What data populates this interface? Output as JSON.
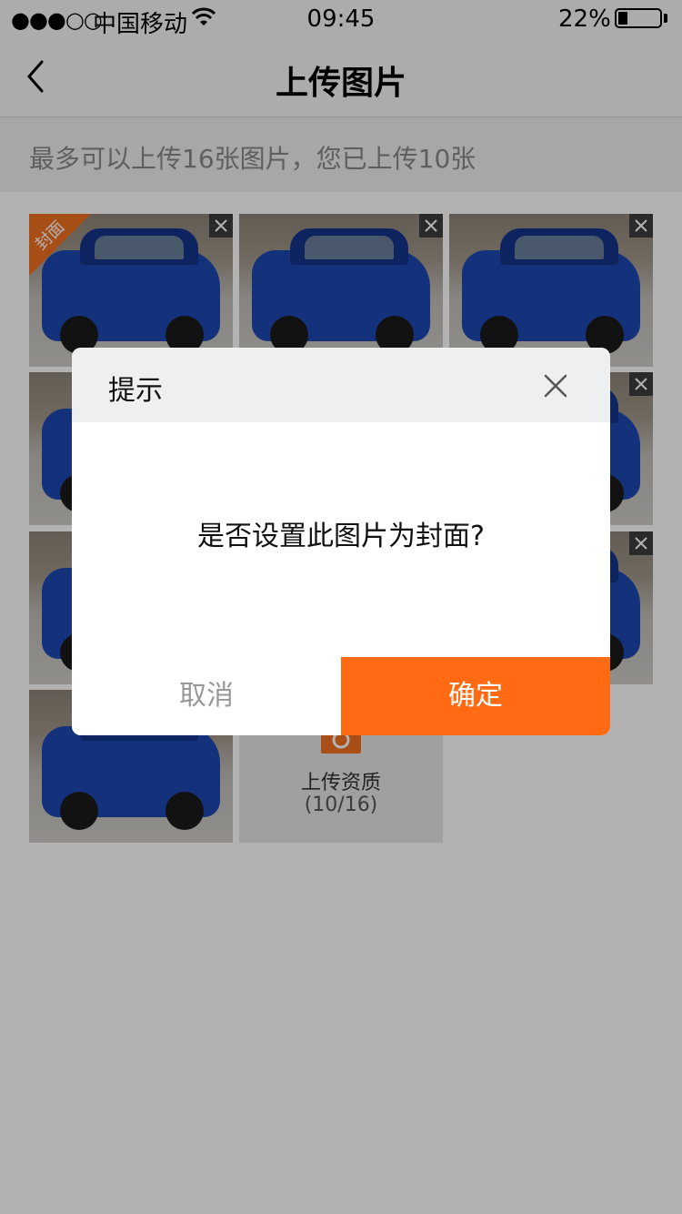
{
  "status_bar": {
    "signal": "●●●○○",
    "carrier": "中国移动",
    "time": "09:45",
    "battery_text": "22%",
    "battery_level": 0.22
  },
  "nav": {
    "title": "上传图片"
  },
  "info": {
    "text": "最多可以上传16张图片，您已上传10张"
  },
  "grid": {
    "cover_badge": "封面",
    "upload_label": "上传资质",
    "upload_count": "(10/16)"
  },
  "dialog": {
    "title": "提示",
    "message": "是否设置此图片为封面?",
    "cancel_label": "取消",
    "confirm_label": "确定"
  },
  "colors": {
    "accent": "#ff6a13",
    "cover_badge": "#f07020"
  }
}
